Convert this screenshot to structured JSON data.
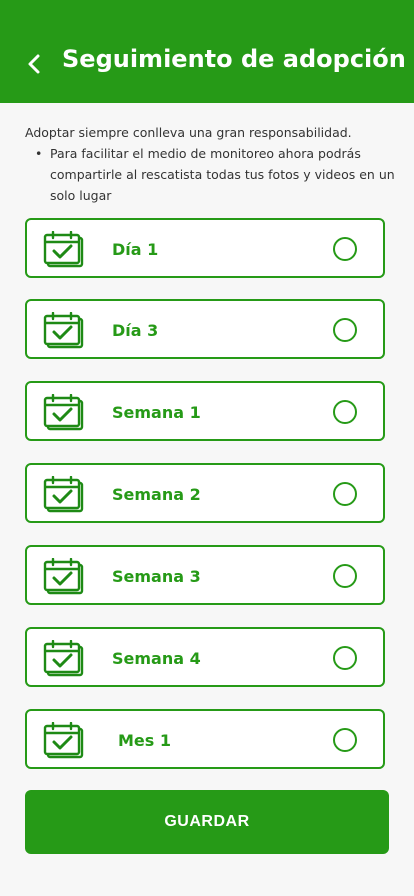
{
  "header": {
    "title": "Seguimiento de adopción",
    "back_icon": "chevron-left-icon"
  },
  "intro": {
    "text": "Adoptar siempre conlleva una gran responsabilidad.",
    "bullet": "Para facilitar el medio de monitoreo ahora podrás compartirle al rescatista todas tus fotos y videos en un solo lugar"
  },
  "items": [
    {
      "label": "Día 1",
      "checked": false
    },
    {
      "label": "Día 3",
      "checked": false
    },
    {
      "label": "Semana 1",
      "checked": false
    },
    {
      "label": "Semana 2",
      "checked": false
    },
    {
      "label": "Semana 3",
      "checked": false
    },
    {
      "label": "Semana 4",
      "checked": false
    },
    {
      "label": "Mes 1",
      "checked": false
    }
  ],
  "save_label": "GUARDAR",
  "colors": {
    "accent": "#269a17",
    "background": "#f7f7f7"
  }
}
